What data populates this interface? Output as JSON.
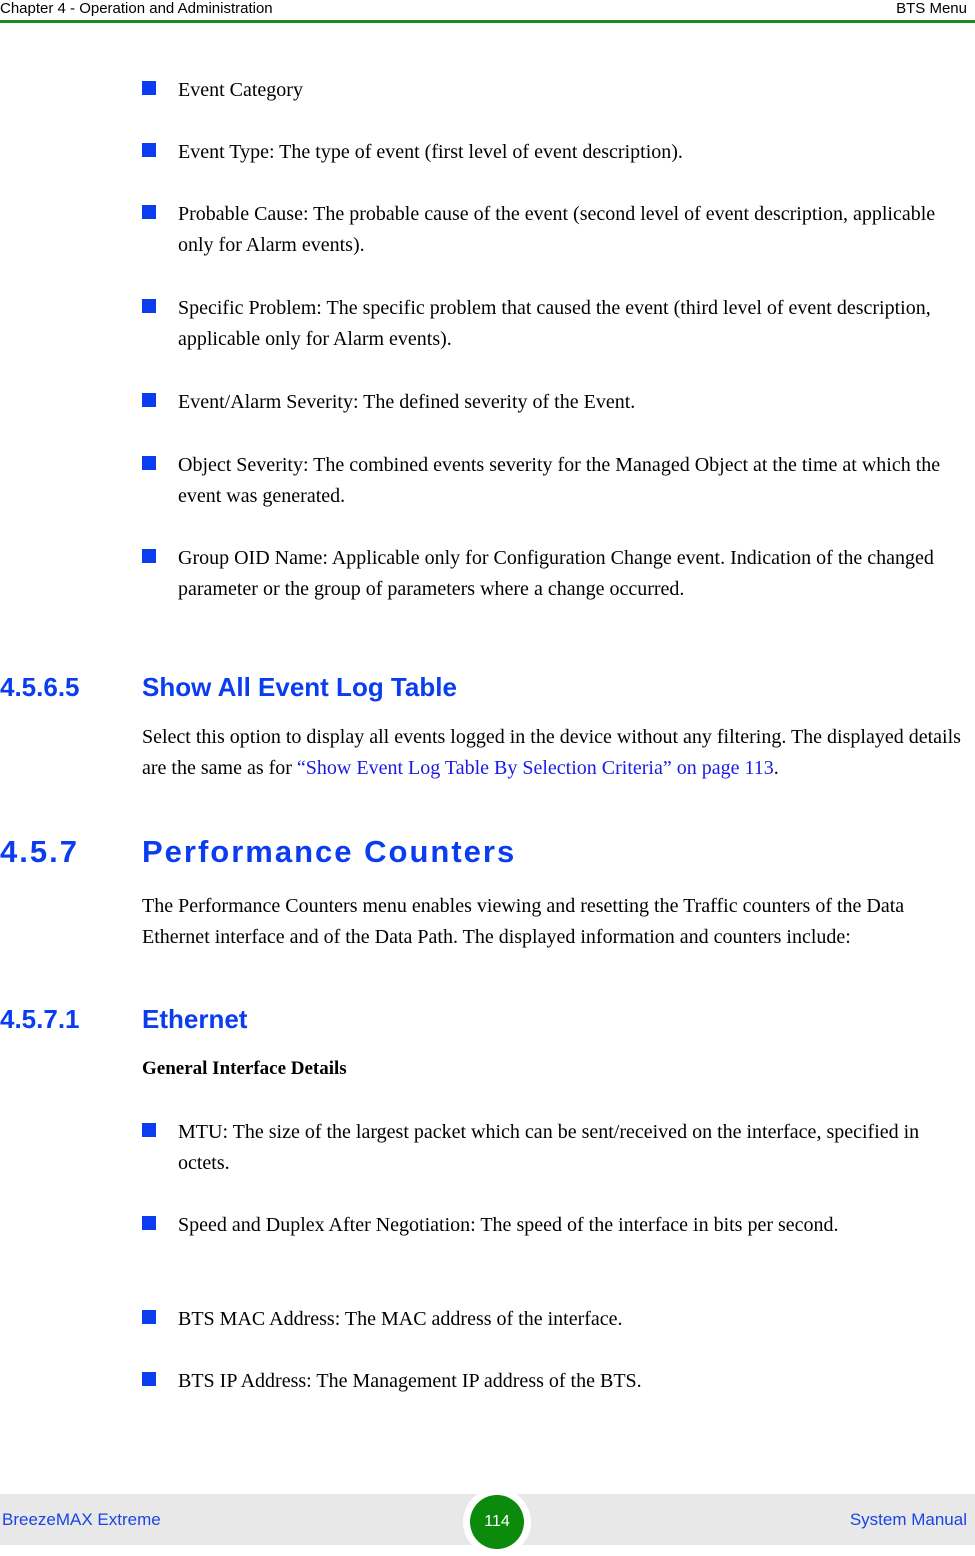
{
  "header": {
    "chapter": "Chapter 4 - Operation and Administration",
    "section": "BTS Menu",
    "rule_color": "#1f8a1f"
  },
  "event_fields": [
    "Event Category",
    "Event Type: The type of event (first level of event description).",
    "Probable Cause: The probable cause of the event (second level of event description, applicable only for Alarm events).",
    "Specific Problem: The specific problem that caused the event (third level of event description, applicable only for Alarm events).",
    "Event/Alarm Severity: The defined severity of the Event.",
    "Object Severity: The combined events severity for the Managed Object at the time at which the event was generated.",
    "Group OID Name: Applicable only for Configuration Change event. Indication of the changed parameter or the group of parameters where a change occurred."
  ],
  "section_4565": {
    "number": "4.5.6.5",
    "title": "Show All Event Log Table",
    "body_pre": "Select this option to display all events logged in the device without any filtering. The displayed details are the same as for ",
    "link_text": "“Show Event Log Table By Selection Criteria” on page 113",
    "body_post": "."
  },
  "section_457": {
    "number": "4.5.7",
    "title": "Performance Counters",
    "body": "The Performance Counters menu enables viewing and resetting the Traffic counters of the Data Ethernet interface and of the Data Path. The displayed information and counters include:"
  },
  "section_4571": {
    "number": "4.5.7.1",
    "title": "Ethernet",
    "subheading": "General Interface Details",
    "items": [
      "MTU: The size of the largest packet which can be sent/received on the interface, specified in octets.",
      "Speed and Duplex After Negotiation: The speed of the interface in bits per second.",
      "BTS MAC Address: The MAC address of the interface.",
      "BTS IP Address: The Management IP address of the BTS."
    ]
  },
  "footer": {
    "product": "BreezeMAX Extreme",
    "page_number": "114",
    "doc_type": "System Manual"
  },
  "colors": {
    "heading_blue": "#0a3cf0",
    "bullet_blue": "#0a3cf0",
    "link_blue": "#1a1ae6",
    "footer_text": "#1a44e6",
    "page_badge": "#0b8a0b",
    "footer_bg": "#e8e8e8"
  }
}
